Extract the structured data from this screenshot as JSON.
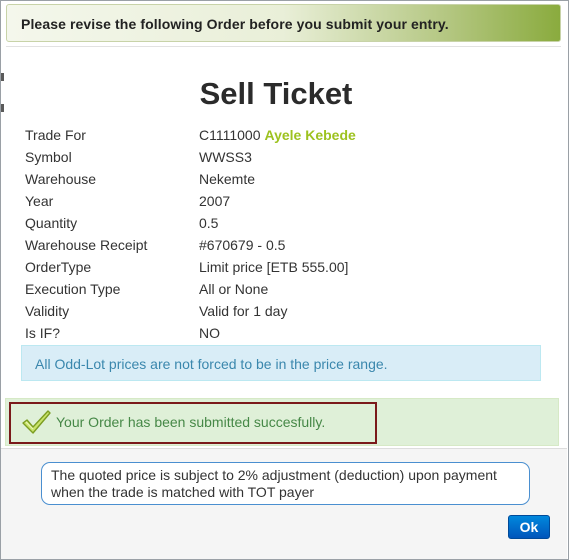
{
  "header": {
    "message": "Please revise the following Order before you submit your entry."
  },
  "ticket": {
    "title": "Sell Ticket",
    "fields": [
      {
        "label": "Trade For",
        "value": "C1111000",
        "extra": "Ayele Kebede"
      },
      {
        "label": "Symbol",
        "value": "WWSS3"
      },
      {
        "label": "Warehouse",
        "value": "Nekemte"
      },
      {
        "label": "Year",
        "value": "2007"
      },
      {
        "label": "Quantity",
        "value": "0.5"
      },
      {
        "label": "Warehouse Receipt",
        "value": "#670679 - 0.5"
      },
      {
        "label": "OrderType",
        "value": "Limit price [ETB 555.00]"
      },
      {
        "label": "Execution Type",
        "value": "All or None"
      },
      {
        "label": "Validity",
        "value": "Valid for 1 day"
      },
      {
        "label": "Is IF?",
        "value": "NO"
      }
    ]
  },
  "info": {
    "message": "All Odd-Lot prices are not forced to be in the price range."
  },
  "success": {
    "icon": "checkmark-icon",
    "message": "Your Order has been submitted succesfully."
  },
  "footer": {
    "note": "The quoted price is subject to 2% adjustment (deduction) upon payment when the trade is matched with TOT payer",
    "ok_label": "Ok"
  },
  "colors": {
    "trader_name": "#9dc21f",
    "info_text": "#3a87ad",
    "success_text": "#468847",
    "ok_button": "#0066cc"
  }
}
